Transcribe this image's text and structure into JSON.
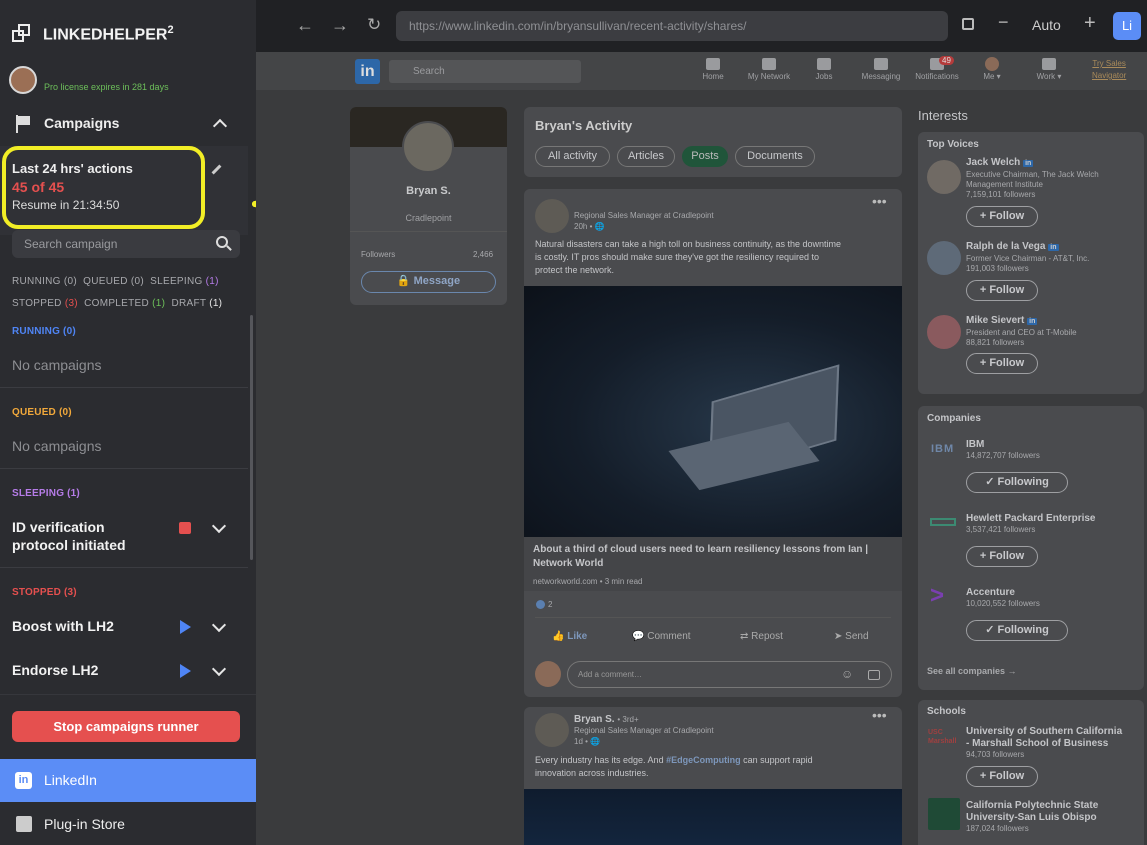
{
  "sidebar": {
    "app_name": "LINKEDHELPER",
    "app_version": "2",
    "license": "Pro license expires in 281 days",
    "campaigns_label": "Campaigns",
    "actions": {
      "title": "Last 24 hrs' actions",
      "count": "45 of 45",
      "resume": "Resume in 21:34:50"
    },
    "search_placeholder": "Search campaign",
    "filters_row1": [
      {
        "label": "RUNNING",
        "count": "(0)",
        "color": "#a8a9ad"
      },
      {
        "label": "QUEUED",
        "count": "(0)",
        "color": "#a8a9ad"
      },
      {
        "label": "SLEEPING",
        "count": "(1)",
        "color": "#b67ce8"
      }
    ],
    "filters_row2": [
      {
        "label": "STOPPED",
        "count": "(3)",
        "color": "#e5504f"
      },
      {
        "label": "COMPLETED",
        "count": "(1)",
        "color": "#6dbf5a"
      },
      {
        "label": "DRAFT",
        "count": "(1)",
        "color": "#e6e6e6"
      }
    ],
    "sections": {
      "running": {
        "label": "RUNNING (0)",
        "color": "#4f85f5",
        "empty": "No campaigns"
      },
      "queued": {
        "label": "QUEUED (0)",
        "color": "#f2a93b",
        "empty": "No campaigns"
      },
      "sleeping": {
        "label": "SLEEPING (1)",
        "color": "#b67ce8",
        "campaign": "ID verification protocol initiated"
      },
      "stopped": {
        "label": "STOPPED (3)",
        "color": "#e5504f",
        "campaigns": [
          "Boost with LH2",
          "Endorse LH2"
        ]
      }
    },
    "stop_button": "Stop campaigns runner",
    "nav": [
      {
        "label": "LinkedIn",
        "active": true
      },
      {
        "label": "Plug-in Store",
        "active": false
      }
    ]
  },
  "browser": {
    "url": "https://www.linkedin.com/in/bryansullivan/recent-activity/shares/",
    "zoom": "Auto",
    "avatar_letters": "Li"
  },
  "linkedin": {
    "search_placeholder": "Search",
    "nav": [
      {
        "label": "Home",
        "badge": ""
      },
      {
        "label": "My Network",
        "badge": ""
      },
      {
        "label": "Jobs",
        "badge": ""
      },
      {
        "label": "Messaging",
        "badge": ""
      },
      {
        "label": "Notifications",
        "badge": "49"
      },
      {
        "label": "Me ▾",
        "badge": ""
      },
      {
        "label": "Work ▾",
        "badge": ""
      }
    ],
    "try_sales": [
      "Try Sales",
      "Navigator"
    ],
    "profile": {
      "name": "Bryan S.",
      "company": "Cradlepoint",
      "followers_label": "Followers",
      "followers": "2,466",
      "message": "Message"
    },
    "activity": {
      "title": "Bryan's Activity",
      "tabs": [
        "All activity",
        "Articles",
        "Posts",
        "Documents"
      ],
      "active_tab": "Posts"
    },
    "post1": {
      "headline": "Regional Sales Manager at Cradlepoint",
      "time": "20h • 🌐",
      "text": [
        "Natural disasters can take a high toll on business continuity, as the downtime",
        "is costly. IT pros should make sure they've got the resiliency required to",
        "protect the network."
      ],
      "link_title": [
        "About a third of cloud users need to learn resiliency lessons from Ian |",
        "Network World"
      ],
      "link_source": "networkworld.com • 3 min read",
      "reactions": "2",
      "actions": [
        "Like",
        "Comment",
        "Repost",
        "Send"
      ],
      "comment_placeholder": "Add a comment…"
    },
    "post2": {
      "name": "Bryan S.",
      "degree": "• 3rd+",
      "headline": "Regional Sales Manager at Cradlepoint",
      "time": "1d • 🌐",
      "text_before": "Every industry has its edge. And ",
      "hashtag": "#EdgeComputing",
      "text_after": " can support rapid",
      "text_line2": "innovation across industries."
    },
    "interests_title": "Interests",
    "top_voices": {
      "title": "Top Voices",
      "people": [
        {
          "name": "Jack Welch",
          "desc": [
            "Executive Chairman, The Jack Welch",
            "Management Institute"
          ],
          "followers": "7,159,101 followers",
          "btn": "+ Follow"
        },
        {
          "name": "Ralph de la Vega",
          "desc": [
            "Former Vice Chairman - AT&T, Inc."
          ],
          "followers": "191,003 followers",
          "btn": "+ Follow"
        },
        {
          "name": "Mike Sievert",
          "desc": [
            "President and CEO at T-Mobile"
          ],
          "followers": "88,821 followers",
          "btn": "+ Follow"
        }
      ]
    },
    "companies": {
      "title": "Companies",
      "items": [
        {
          "name": "IBM",
          "followers": "14,872,707 followers",
          "btn": "✓ Following"
        },
        {
          "name": "Hewlett Packard Enterprise",
          "followers": "3,537,421 followers",
          "btn": "+ Follow"
        },
        {
          "name": "Accenture",
          "followers": "10,020,552 followers",
          "btn": "✓ Following"
        }
      ],
      "see_all": "See all companies →"
    },
    "schools": {
      "title": "Schools",
      "items": [
        {
          "name": [
            "University of Southern California",
            "- Marshall School of Business"
          ],
          "followers": "94,703 followers",
          "btn": "+ Follow",
          "logo": "USC Marshall"
        },
        {
          "name": [
            "California Polytechnic State",
            "University-San Luis Obispo"
          ],
          "followers": "187,024 followers"
        }
      ]
    }
  },
  "colors": {
    "accent": "#5b8df6",
    "highlight": "#f2ee26",
    "danger": "#e5504f"
  }
}
